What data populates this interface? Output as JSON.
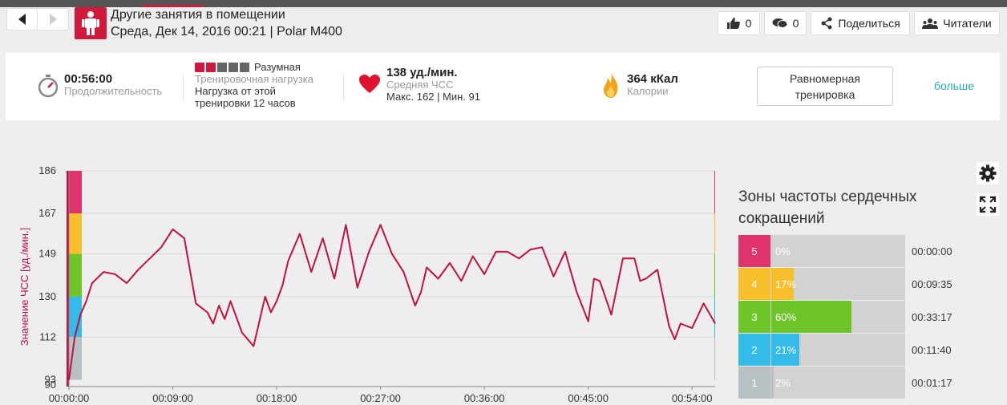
{
  "header": {
    "title": "Другие занятия в помещении",
    "subtitle": "Среда, Дек 14, 2016 00:21 | Polar M400",
    "like_count": "0",
    "comment_count": "0",
    "share_label": "Поделиться",
    "readers_label": "Читатели"
  },
  "summary": {
    "duration_value": "00:56:00",
    "duration_label": "Продолжительность",
    "load_level": "Разумная",
    "load_label": "Тренировочная нагрузка",
    "load_note_line1": "Нагрузка от этой",
    "load_note_line2": "тренировки 12 часов",
    "hr_value": "138 уд./мин.",
    "hr_label": "Средняя ЧСС",
    "hr_minmax": "Макс. 162  |  Мин. 91",
    "calories_value": "364 кКал",
    "calories_label": "Калории",
    "benefit_line1": "Равномерная",
    "benefit_line2": "тренировка",
    "more_label": "больше"
  },
  "zones": {
    "title": "Зоны частоты сердечных сокращений",
    "rows": [
      {
        "num": "5",
        "pct": "0%",
        "time": "00:00:00",
        "color": "#e0336b",
        "fraction": 0.0
      },
      {
        "num": "4",
        "pct": "17%",
        "time": "00:09:35",
        "color": "#f7bf2b",
        "fraction": 0.17
      },
      {
        "num": "3",
        "pct": "60%",
        "time": "00:33:17",
        "color": "#6ec52a",
        "fraction": 0.6
      },
      {
        "num": "2",
        "pct": "21%",
        "time": "00:11:40",
        "color": "#33bbea",
        "fraction": 0.21
      },
      {
        "num": "1",
        "pct": "2%",
        "time": "00:01:17",
        "color": "#b8c0c4",
        "fraction": 0.02
      }
    ]
  },
  "chart_data": {
    "type": "line",
    "ylabel": "Значение ЧСС [уд./мин.]",
    "xlabel": "",
    "ylim": [
      90,
      186
    ],
    "xlim_seconds": [
      0,
      3360
    ],
    "y_ticks": [
      186,
      167,
      149,
      130,
      112,
      93,
      90
    ],
    "x_ticks": [
      "00:00:00",
      "00:09:00",
      "00:18:00",
      "00:27:00",
      "00:36:00",
      "00:45:00",
      "00:54:00"
    ],
    "zone_bands": [
      {
        "zone": "5",
        "from": 167,
        "to": 186,
        "color": "#e0336b"
      },
      {
        "zone": "4",
        "from": 149,
        "to": 167,
        "color": "#f7bf2b"
      },
      {
        "zone": "3",
        "from": 130,
        "to": 149,
        "color": "#6ec52a"
      },
      {
        "zone": "2",
        "from": 112,
        "to": 130,
        "color": "#33bbea"
      },
      {
        "zone": "1",
        "from": 93,
        "to": 112,
        "color": "#b8c0c4"
      }
    ],
    "line_color": "#c2113c",
    "series": [
      {
        "name": "",
        "x": [
          "00:00:00",
          "00:00:30",
          "00:01:00",
          "00:01:30",
          "00:02:00",
          "00:03:00",
          "00:04:00",
          "00:05:00",
          "00:06:00",
          "00:07:00",
          "00:08:00",
          "00:09:00",
          "00:10:00",
          "00:11:00",
          "00:12:00",
          "00:12:30",
          "00:13:00",
          "00:13:30",
          "00:14:00",
          "00:15:00",
          "00:16:00",
          "00:17:00",
          "00:17:30",
          "00:18:00",
          "00:18:30",
          "00:19:00",
          "00:20:00",
          "00:21:00",
          "00:22:00",
          "00:23:00",
          "00:24:00",
          "00:25:00",
          "00:26:00",
          "00:27:00",
          "00:28:00",
          "00:29:00",
          "00:30:00",
          "00:30:30",
          "00:31:00",
          "00:32:00",
          "00:33:00",
          "00:34:00",
          "00:35:00",
          "00:36:00",
          "00:37:00",
          "00:38:00",
          "00:39:00",
          "00:40:00",
          "00:41:00",
          "00:42:00",
          "00:43:00",
          "00:44:00",
          "00:45:00",
          "00:45:30",
          "00:46:00",
          "00:47:00",
          "00:48:00",
          "00:49:00",
          "00:49:30",
          "00:50:00",
          "00:51:00",
          "00:52:00",
          "00:52:30",
          "00:53:00",
          "00:54:00",
          "00:55:00",
          "00:56:00"
        ],
        "y": [
          93,
          112,
          122,
          128,
          136,
          141,
          140,
          136,
          142,
          147,
          152,
          160,
          156,
          127,
          123,
          118,
          126,
          120,
          128,
          114,
          108,
          130,
          123,
          128,
          135,
          146,
          158,
          141,
          156,
          138,
          162,
          134,
          150,
          162,
          149,
          141,
          126,
          132,
          143,
          138,
          145,
          137,
          148,
          140,
          150,
          150,
          147,
          151,
          152,
          139,
          150,
          132,
          119,
          138,
          137,
          122,
          147,
          147,
          137,
          138,
          142,
          117,
          111,
          118,
          116,
          127,
          118
        ]
      }
    ]
  }
}
